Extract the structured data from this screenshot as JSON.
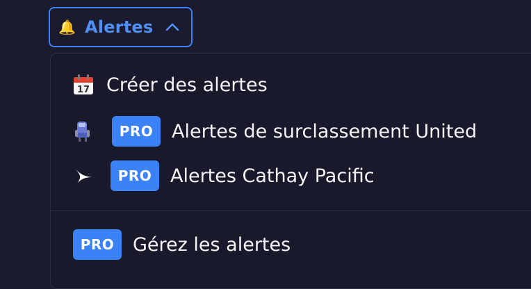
{
  "trigger": {
    "label": "Alertes",
    "bell_icon": "🔔"
  },
  "menu": {
    "items": [
      {
        "icon": "calendar-icon",
        "emoji": "📅",
        "label": "Créer des alertes"
      },
      {
        "icon": "airline-seat-icon",
        "badge": "PRO",
        "label": "Alertes de surclassement United"
      },
      {
        "icon": "cathay-logo-icon",
        "badge": "PRO",
        "label": "Alertes Cathay Pacific"
      }
    ],
    "footer": {
      "badge": "PRO",
      "label": "Gérez les alertes"
    }
  },
  "colors": {
    "accent": "#3b82f6",
    "background": "#1a1b2e",
    "text": "#f3f4f8"
  }
}
